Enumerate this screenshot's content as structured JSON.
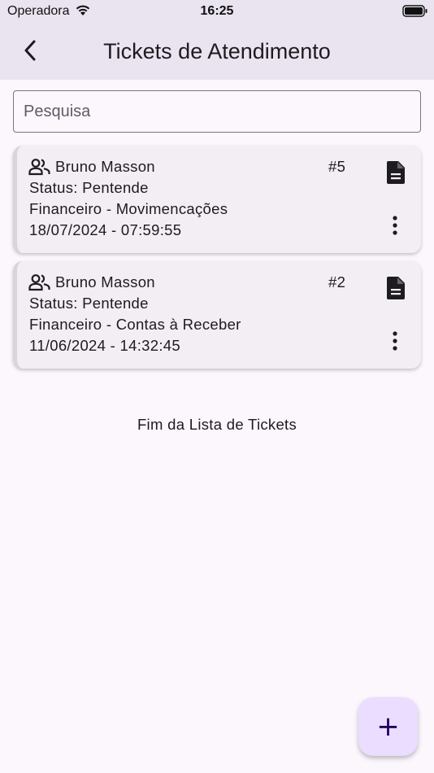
{
  "status_bar": {
    "carrier": "Operadora",
    "time": "16:25",
    "icons": [
      "wifi-icon",
      "battery-icon"
    ]
  },
  "header": {
    "title": "Tickets de Atendimento",
    "back_icon": "chevron-left-icon"
  },
  "search": {
    "placeholder": "Pesquisa",
    "value": ""
  },
  "tickets": [
    {
      "user": "Bruno Masson",
      "number": "#5",
      "status": "Status: Pentende",
      "category": "Financeiro - Movimencações",
      "datetime": "18/07/2024 - 07:59:55"
    },
    {
      "user": "Bruno Masson",
      "number": "#2",
      "status": "Status: Pentende",
      "category": "Financeiro - Contas à Receber",
      "datetime": "11/06/2024 - 14:32:45"
    }
  ],
  "end_of_list": "Fim da Lista de Tickets",
  "fab": {
    "label": "+",
    "icon": "add-icon"
  },
  "colors": {
    "background": "#fcf6fd",
    "header": "#e9e4f0",
    "card": "#f2eef3",
    "fab": "#eaddff"
  }
}
